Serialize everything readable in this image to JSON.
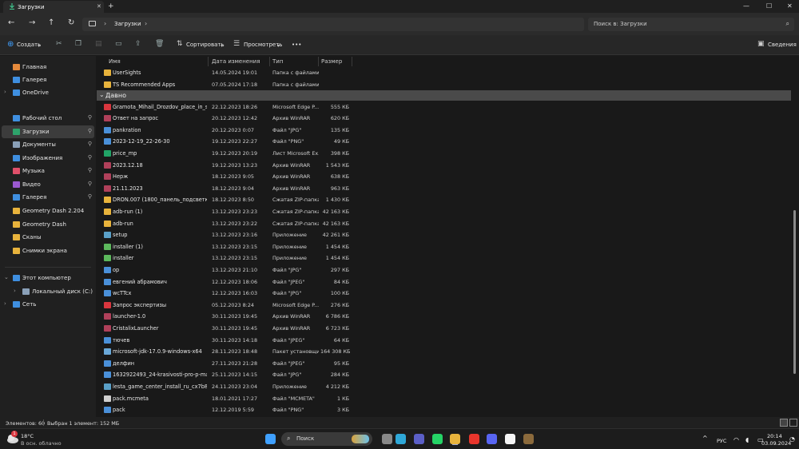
{
  "window": {
    "tab_title": "Загрузки",
    "tab_close": "✕",
    "tab_add": "+",
    "controls": {
      "minimize": "—",
      "maximize": "☐",
      "close": "✕"
    }
  },
  "nav": {
    "back": "←",
    "forward": "→",
    "up": "↑",
    "refresh": "↻",
    "chevron": "›",
    "breadcrumb": "Загрузки",
    "search_placeholder": "Поиск в: Загрузки",
    "search_icon": "⌕"
  },
  "toolbar": {
    "create_label": "Создать",
    "sort_label": "Сортировать",
    "view_label": "Просмотреть",
    "more_label": "•••",
    "details_label": "Сведения",
    "icons": [
      "cut-icon",
      "copy-icon",
      "paste-icon",
      "rename-icon",
      "share-icon",
      "delete-icon"
    ]
  },
  "sidebar": {
    "items": [
      {
        "label": "Главная",
        "icon": "home-icon",
        "color": "#e58a3c"
      },
      {
        "label": "Галерея",
        "icon": "gallery-icon",
        "color": "#3f8fe0"
      },
      {
        "label": "OneDrive",
        "icon": "cloud-icon",
        "color": "#3f8fe0",
        "expandable": true
      },
      {
        "label": "Рабочий стол",
        "icon": "desktop-icon",
        "color": "#3f8fe0",
        "pinned": true
      },
      {
        "label": "Загрузки",
        "icon": "downloads-icon",
        "color": "#2ea36b",
        "pinned": true,
        "selected": true
      },
      {
        "label": "Документы",
        "icon": "documents-icon",
        "color": "#8aa0b8",
        "pinned": true
      },
      {
        "label": "Изображения",
        "icon": "pictures-icon",
        "color": "#3f8fe0",
        "pinned": true
      },
      {
        "label": "Музыка",
        "icon": "music-icon",
        "color": "#e0506a",
        "pinned": true
      },
      {
        "label": "Видео",
        "icon": "video-icon",
        "color": "#9b59d0",
        "pinned": true
      },
      {
        "label": "Галерея",
        "icon": "gallery-icon",
        "color": "#3f8fe0",
        "pinned": true
      },
      {
        "label": "Geometry Dash 2.204",
        "icon": "folder-icon",
        "color": "#e8b33c"
      },
      {
        "label": "Geometry Dash",
        "icon": "folder-icon",
        "color": "#e8b33c"
      },
      {
        "label": "Сканы",
        "icon": "folder-icon",
        "color": "#e8b33c"
      },
      {
        "label": "Снимки экрана",
        "icon": "folder-icon",
        "color": "#e8b33c"
      },
      {
        "label": "Этот компьютер",
        "icon": "computer-icon",
        "color": "#3f8fe0",
        "expandable": true,
        "expanded": true
      },
      {
        "label": "Локальный диск (C:)",
        "icon": "drive-icon",
        "color": "#8aa0b8",
        "expandable": true
      },
      {
        "label": "Сеть",
        "icon": "network-icon",
        "color": "#3f8fe0",
        "expandable": true
      }
    ]
  },
  "columns": {
    "name": "Имя",
    "date": "Дата изменения",
    "type": "Тип",
    "size": "Размер"
  },
  "group_label": "Давно",
  "files_top": [
    {
      "name": "UserSights",
      "date": "14.05.2024 19:01",
      "type": "Папка с файлами",
      "size": "",
      "icon": "folder-icon"
    },
    {
      "name": "TS Recommended Apps",
      "date": "07.05.2024 17:18",
      "type": "Папка с файлами",
      "size": "",
      "icon": "folder-icon"
    }
  ],
  "files": [
    {
      "name": "Gramota_Mihail_Drozdov_place_in_scho...",
      "date": "22.12.2023 18:26",
      "type": "Microsoft Edge P...",
      "size": "555 КБ",
      "icon": "pdf-icon"
    },
    {
      "name": "Ответ на запрос",
      "date": "20.12.2023 12:42",
      "type": "Архив WinRAR",
      "size": "620 КБ",
      "icon": "winrar-icon"
    },
    {
      "name": "pankration",
      "date": "20.12.2023 0:07",
      "type": "Файл \"JPG\"",
      "size": "135 КБ",
      "icon": "image-file-icon"
    },
    {
      "name": "2023-12-19_22-26-30",
      "date": "19.12.2023 22:27",
      "type": "Файл \"PNG\"",
      "size": "49 КБ",
      "icon": "image-file-icon"
    },
    {
      "name": "price_mp",
      "date": "19.12.2023 20:19",
      "type": "Лист Microsoft Ex...",
      "size": "398 КБ",
      "icon": "excel-icon"
    },
    {
      "name": "2023.12.18",
      "date": "19.12.2023 13:23",
      "type": "Архив WinRAR",
      "size": "1 543 КБ",
      "icon": "winrar-icon"
    },
    {
      "name": "Нерж",
      "date": "18.12.2023 9:05",
      "type": "Архив WinRAR",
      "size": "638 КБ",
      "icon": "winrar-icon"
    },
    {
      "name": "21.11.2023",
      "date": "18.12.2023 9:04",
      "type": "Архив WinRAR",
      "size": "963 КБ",
      "icon": "winrar-icon"
    },
    {
      "name": "DRON.007 (1800_панель_подсветка_с_н...",
      "date": "18.12.2023 8:50",
      "type": "Сжатая ZIP-папка",
      "size": "1 430 КБ",
      "icon": "zip-icon"
    },
    {
      "name": "adb-run (1)",
      "date": "13.12.2023 23:23",
      "type": "Сжатая ZIP-папка",
      "size": "42 163 КБ",
      "icon": "zip-icon"
    },
    {
      "name": "adb-run",
      "date": "13.12.2023 23:22",
      "type": "Сжатая ZIP-папка",
      "size": "42 163 КБ",
      "icon": "zip-icon"
    },
    {
      "name": "setup",
      "date": "13.12.2023 23:16",
      "type": "Приложение",
      "size": "42 261 КБ",
      "icon": "app-icon"
    },
    {
      "name": "installer (1)",
      "date": "13.12.2023 23:15",
      "type": "Приложение",
      "size": "1 454 КБ",
      "icon": "installer-icon"
    },
    {
      "name": "installer",
      "date": "13.12.2023 23:15",
      "type": "Приложение",
      "size": "1 454 КБ",
      "icon": "installer-icon"
    },
    {
      "name": "op",
      "date": "13.12.2023 21:10",
      "type": "Файл \"JPG\"",
      "size": "297 КБ",
      "icon": "image-file-icon"
    },
    {
      "name": "евгений абрамович",
      "date": "12.12.2023 18:06",
      "type": "Файл \"JPEG\"",
      "size": "84 КБ",
      "icon": "image-file-icon"
    },
    {
      "name": "wcTTcx",
      "date": "12.12.2023 16:03",
      "type": "Файл \"JPG\"",
      "size": "100 КБ",
      "icon": "image-file-icon"
    },
    {
      "name": "Запрос экспертизы",
      "date": "05.12.2023 8:24",
      "type": "Microsoft Edge P...",
      "size": "276 КБ",
      "icon": "pdf-icon"
    },
    {
      "name": "launcher-1.0",
      "date": "30.11.2023 19:45",
      "type": "Архив WinRAR",
      "size": "6 786 КБ",
      "icon": "winrar-icon"
    },
    {
      "name": "CristalixLauncher",
      "date": "30.11.2023 19:45",
      "type": "Архив WinRAR",
      "size": "6 723 КБ",
      "icon": "winrar-icon"
    },
    {
      "name": "тючев",
      "date": "30.11.2023 14:18",
      "type": "Файл \"JPEG\"",
      "size": "64 КБ",
      "icon": "image-file-icon"
    },
    {
      "name": "microsoft-jdk-17.0.9-windows-x64",
      "date": "28.11.2023 18:48",
      "type": "Пакет установщи...",
      "size": "164 308 КБ",
      "icon": "msi-icon"
    },
    {
      "name": "делфин",
      "date": "27.11.2023 21:28",
      "type": "Файл \"JPEG\"",
      "size": "95 КБ",
      "icon": "image-file-icon"
    },
    {
      "name": "1632922493_24-krasivosti-pro-p-malenki...",
      "date": "25.11.2023 14:15",
      "type": "Файл \"JPG\"",
      "size": "284 КБ",
      "icon": "image-file-icon"
    },
    {
      "name": "lesta_game_center_install_ru_cx7b885jtqe8",
      "date": "24.11.2023 23:04",
      "type": "Приложение",
      "size": "4 212 КБ",
      "icon": "app-icon"
    },
    {
      "name": "pack.mcmeta",
      "date": "18.01.2021 17:27",
      "type": "Файл \"MCMETA\"",
      "size": "1 КБ",
      "icon": "file-icon"
    },
    {
      "name": "pack",
      "date": "12.12.2019 5:59",
      "type": "Файл \"PNG\"",
      "size": "3 КБ",
      "icon": "image-file-icon"
    }
  ],
  "status": {
    "count": "Элементов: 60",
    "selected": "Выбран 1 элемент: 152 МБ"
  },
  "taskbar": {
    "temp": "18°C",
    "weather_desc": "В осн. облачно",
    "badge": "1",
    "search_label": "Поиск",
    "lang": "РУС",
    "time": "20:14",
    "date": "03.09.2024",
    "tray_chevron": "^",
    "apps": [
      {
        "name": "start-icon",
        "color": "#3fa0ff"
      },
      {
        "name": "widgets-icon",
        "color": "#888888"
      },
      {
        "name": "edge-icon",
        "color": "#2fa8d8"
      },
      {
        "name": "teams-icon",
        "color": "#5b5fc7"
      },
      {
        "name": "whatsapp-icon",
        "color": "#25d366"
      },
      {
        "name": "explorer-icon",
        "color": "#e8b33c"
      },
      {
        "name": "yandex-icon",
        "color": "#e8352c"
      },
      {
        "name": "discord-icon",
        "color": "#5865f2"
      },
      {
        "name": "yandex-browser-icon",
        "color": "#f5f5f5"
      },
      {
        "name": "minecraft-icon",
        "color": "#8b6a3c"
      }
    ]
  }
}
